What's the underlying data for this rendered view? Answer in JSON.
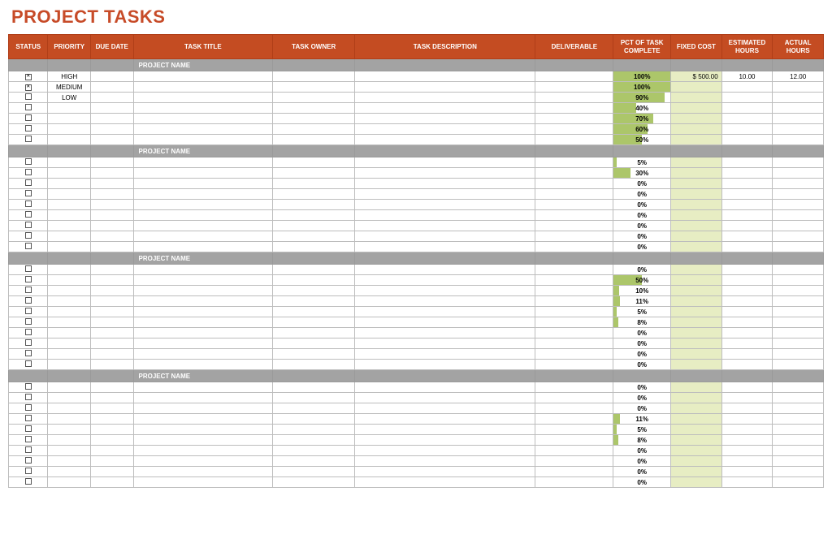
{
  "title": "PROJECT TASKS",
  "columns": {
    "status": "STATUS",
    "priority": "PRIORITY",
    "due_date": "DUE DATE",
    "task_title": "TASK TITLE",
    "task_owner": "TASK OWNER",
    "task_description": "TASK DESCRIPTION",
    "deliverable": "DELIVERABLE",
    "pct_complete": "PCT OF TASK COMPLETE",
    "fixed_cost": "FIXED COST",
    "est_hours": "ESTIMATED HOURS",
    "act_hours": "ACTUAL HOURS"
  },
  "section_label": "PROJECT NAME",
  "sections": [
    {
      "rows": [
        {
          "checked": true,
          "priority": "HIGH",
          "pct": 100,
          "fixed_cost": "$      500.00",
          "est_hours": "10.00",
          "act_hours": "12.00"
        },
        {
          "checked": true,
          "priority": "MEDIUM",
          "pct": 100
        },
        {
          "checked": false,
          "priority": "LOW",
          "pct": 90
        },
        {
          "checked": false,
          "pct": 40
        },
        {
          "checked": false,
          "pct": 70
        },
        {
          "checked": false,
          "pct": 60
        },
        {
          "checked": false,
          "pct": 50
        }
      ]
    },
    {
      "rows": [
        {
          "checked": false,
          "pct": 5
        },
        {
          "checked": false,
          "pct": 30
        },
        {
          "checked": false,
          "pct": 0
        },
        {
          "checked": false,
          "pct": 0
        },
        {
          "checked": false,
          "pct": 0
        },
        {
          "checked": false,
          "pct": 0
        },
        {
          "checked": false,
          "pct": 0
        },
        {
          "checked": false,
          "pct": 0
        },
        {
          "checked": false,
          "pct": 0
        }
      ]
    },
    {
      "rows": [
        {
          "checked": false,
          "pct": 0
        },
        {
          "checked": false,
          "pct": 50
        },
        {
          "checked": false,
          "pct": 10
        },
        {
          "checked": false,
          "pct": 11
        },
        {
          "checked": false,
          "pct": 5
        },
        {
          "checked": false,
          "pct": 8
        },
        {
          "checked": false,
          "pct": 0
        },
        {
          "checked": false,
          "pct": 0
        },
        {
          "checked": false,
          "pct": 0
        },
        {
          "checked": false,
          "pct": 0
        }
      ]
    },
    {
      "rows": [
        {
          "checked": false,
          "pct": 0
        },
        {
          "checked": false,
          "pct": 0
        },
        {
          "checked": false,
          "pct": 0
        },
        {
          "checked": false,
          "pct": 11
        },
        {
          "checked": false,
          "pct": 5
        },
        {
          "checked": false,
          "pct": 8
        },
        {
          "checked": false,
          "pct": 0
        },
        {
          "checked": false,
          "pct": 0
        },
        {
          "checked": false,
          "pct": 0
        },
        {
          "checked": false,
          "pct": 0
        }
      ]
    }
  ]
}
